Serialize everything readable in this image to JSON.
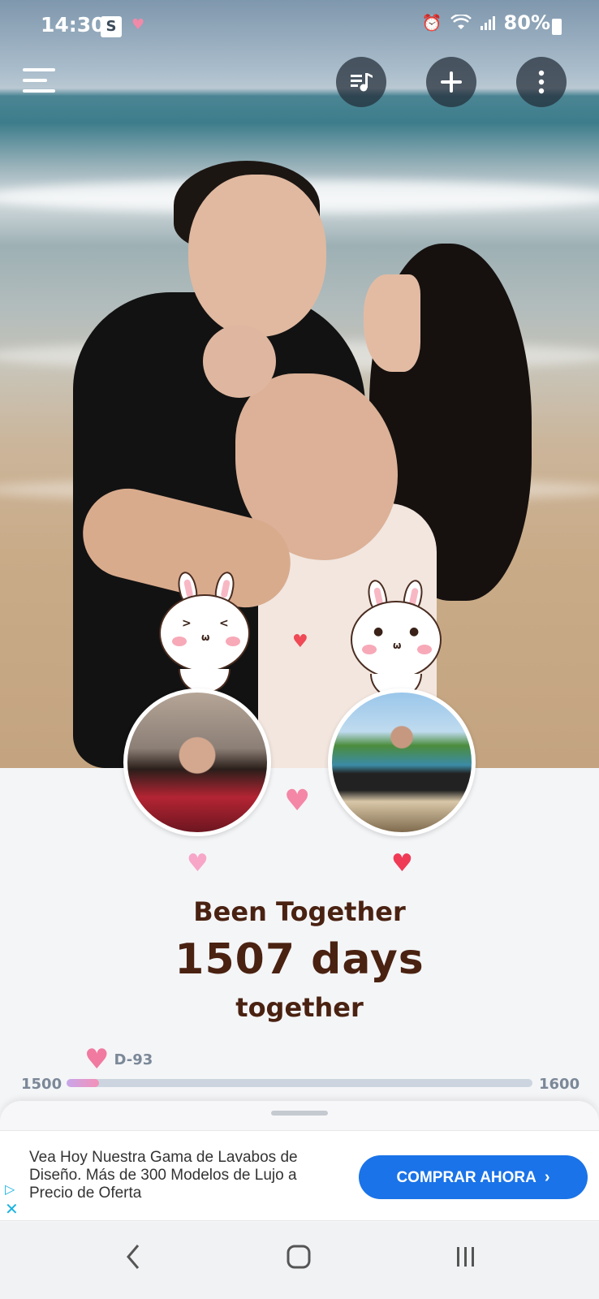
{
  "status_bar": {
    "time": "14:30",
    "s_badge": "S",
    "battery": "80%",
    "icons": [
      "alarm-icon",
      "wifi-icon",
      "signal-icon",
      "battery-icon"
    ]
  },
  "toolbar": {
    "icons": [
      "menu-icon",
      "music-playlist-icon",
      "add-icon",
      "more-vertical-icon"
    ]
  },
  "couple": {
    "partner_left_heart_color": "#f7a6c8",
    "partner_right_heart_color": "#ef3b56",
    "center_heart_color": "#f487a6"
  },
  "counter": {
    "line1": "Been Together",
    "line2": "1507 days",
    "line3": "together"
  },
  "progress": {
    "dday_label": "D-93",
    "min": "1500",
    "max": "1600",
    "current": 1507
  },
  "ad": {
    "text": "Vea Hoy Nuestra Gama de Lavabos de Diseño. Más de 300 Modelos de Lujo a Precio de Oferta",
    "cta": "COMPRAR AHORA",
    "cta_color": "#1a73e8"
  },
  "nav": {
    "icons": [
      "back-icon",
      "home-icon",
      "recents-icon"
    ]
  }
}
